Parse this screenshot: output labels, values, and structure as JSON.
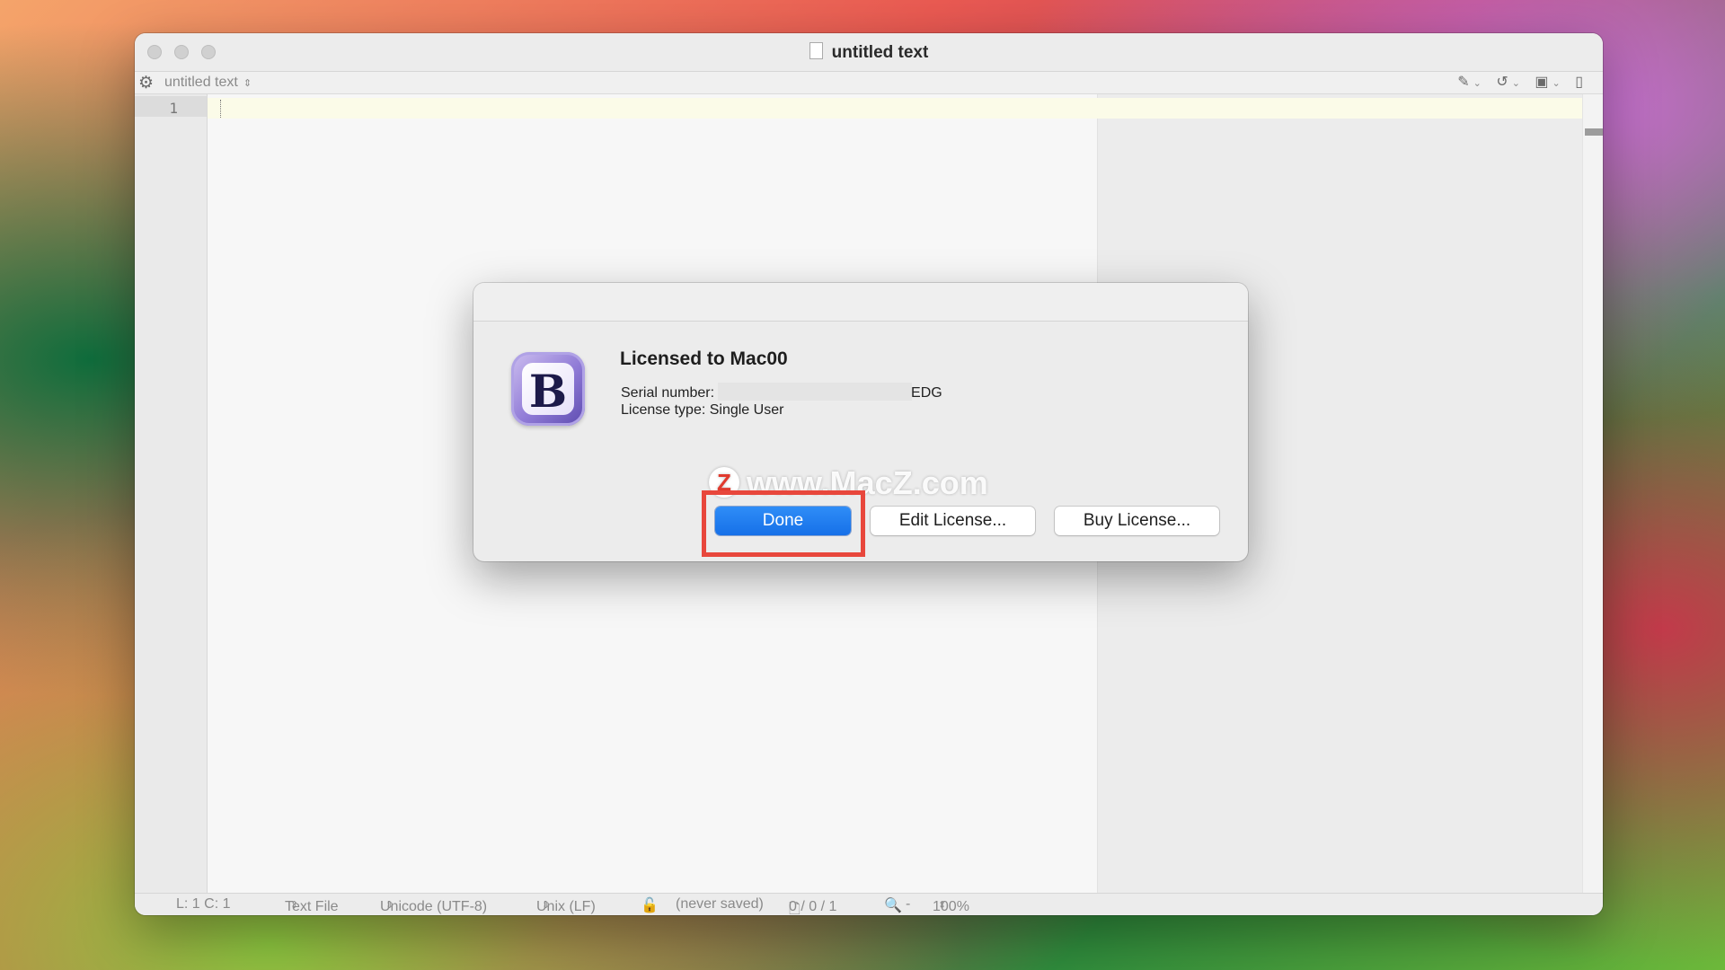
{
  "window": {
    "title": "untitled text",
    "toolbar_doc_name": "untitled text",
    "line_number": "1"
  },
  "status_bar": {
    "position": "L: 1 C: 1",
    "file_type": "Text File",
    "encoding": "Unicode (UTF-8)",
    "line_endings": "Unix (LF)",
    "save_state": "(never saved)",
    "counts": "0 / 0 / 1",
    "zoom_minus": "-",
    "zoom": "100%"
  },
  "dialog": {
    "title": "Licensed to Mac00",
    "serial_label": "Serial number:",
    "serial_suffix": "EDG",
    "license_type": "License type: Single User",
    "app_icon_letter": "B",
    "buttons": {
      "done": "Done",
      "edit": "Edit License...",
      "buy": "Buy License..."
    }
  },
  "watermark": {
    "logo_letter": "Z",
    "text": "www.MacZ.com"
  },
  "colors": {
    "primary_button": "#1670e8",
    "highlight_box": "#e8473c"
  },
  "icons": [
    "gear-icon",
    "document-icon",
    "pencil-icon",
    "history-icon",
    "stack-icon",
    "lock-icon",
    "zoom-icon"
  ]
}
